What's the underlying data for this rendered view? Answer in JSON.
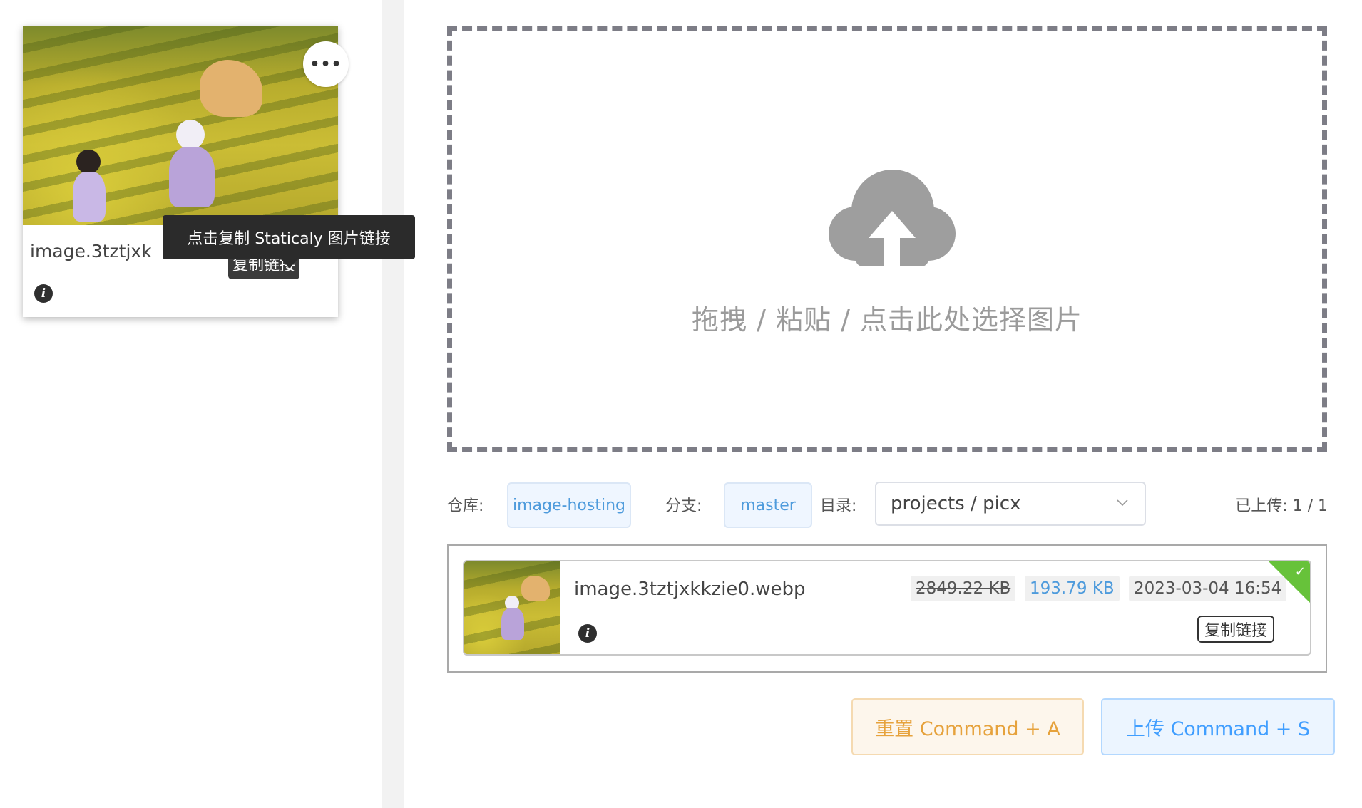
{
  "thumbnail": {
    "file_name": "image.3tztjxkkzie0.webp",
    "more_icon": "ellipsis-icon",
    "info_icon": "info-icon",
    "copy_label": "复制链接",
    "tooltip": "点击复制 Staticaly 图片链接"
  },
  "dropzone": {
    "icon": "cloud-upload-icon",
    "text": "拖拽 / 粘贴 / 点击此处选择图片"
  },
  "settings": {
    "repo_label": "仓库:",
    "repo_value": "image-hosting",
    "branch_label": "分支:",
    "branch_value": "master",
    "dir_label": "目录:",
    "dir_value": "projects / picx",
    "uploaded_text": "已上传: 1 / 1"
  },
  "upload_item": {
    "file_name": "image.3tztjxkkzie0.webp",
    "original_size": "2849.22 KB",
    "compressed_size": "193.79 KB",
    "datetime": "2023-03-04 16:54",
    "copy_label": "复制链接",
    "status_icon": "check-icon"
  },
  "actions": {
    "reset_label": "重置 Command + A",
    "upload_label": "上传 Command + S"
  },
  "colors": {
    "reset": "#e6a23c",
    "upload": "#409eff",
    "success": "#67c23a",
    "chip_text": "#4e9bdc"
  }
}
